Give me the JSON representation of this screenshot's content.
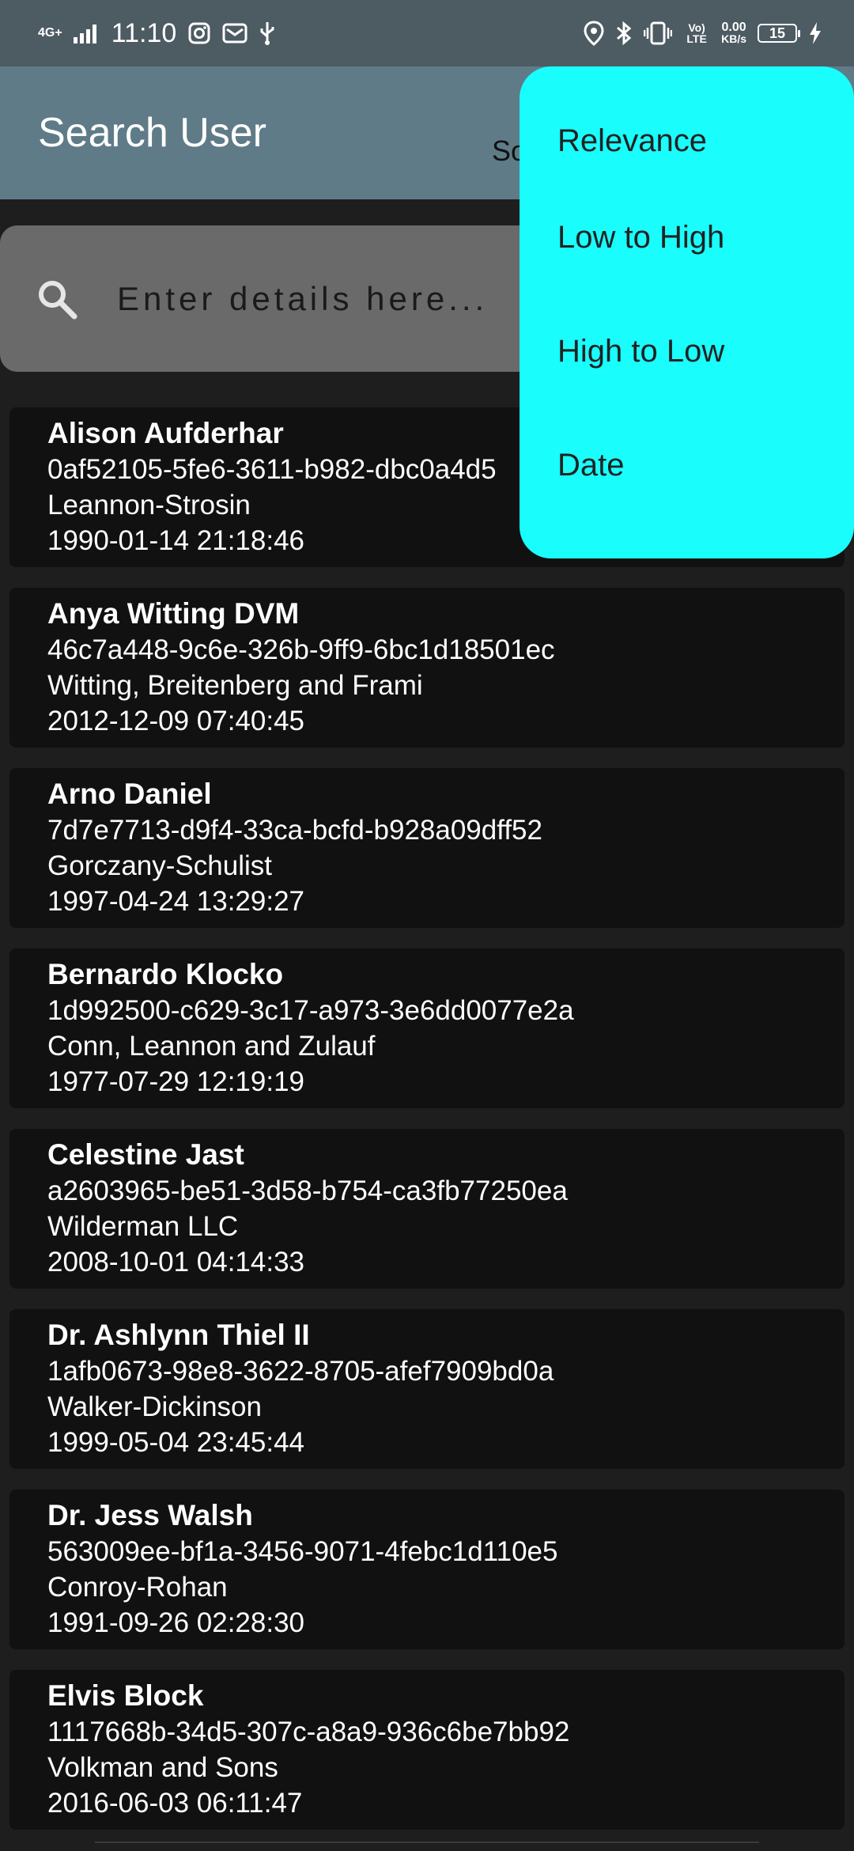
{
  "status_bar": {
    "network": "4G+",
    "time": "11:10",
    "volte": "Vo) LTE",
    "speed_value": "0.00",
    "speed_unit": "KB/s",
    "battery": "15",
    "icons": [
      "signal-icon",
      "instagram-icon",
      "mail-icon",
      "usb-icon",
      "location-icon",
      "bluetooth-icon",
      "vibrate-icon",
      "charging-icon"
    ]
  },
  "app_bar": {
    "title": "Search User",
    "sort_label": "Sor"
  },
  "search": {
    "placeholder": "Enter details here..."
  },
  "users": [
    {
      "name": "Alison Aufderhar",
      "id": "0af52105-5fe6-3611-b982-dbc0a4d5",
      "company": "Leannon-Strosin",
      "date": "1990-01-14 21:18:46"
    },
    {
      "name": "Anya Witting DVM",
      "id": "46c7a448-9c6e-326b-9ff9-6bc1d18501ec",
      "company": "Witting, Breitenberg and Frami",
      "date": "2012-12-09 07:40:45"
    },
    {
      "name": "Arno Daniel",
      "id": "7d7e7713-d9f4-33ca-bcfd-b928a09dff52",
      "company": "Gorczany-Schulist",
      "date": "1997-04-24 13:29:27"
    },
    {
      "name": "Bernardo Klocko",
      "id": "1d992500-c629-3c17-a973-3e6dd0077e2a",
      "company": "Conn, Leannon and Zulauf",
      "date": "1977-07-29 12:19:19"
    },
    {
      "name": "Celestine Jast",
      "id": "a2603965-be51-3d58-b754-ca3fb77250ea",
      "company": "Wilderman LLC",
      "date": "2008-10-01 04:14:33"
    },
    {
      "name": "Dr. Ashlynn Thiel II",
      "id": "1afb0673-98e8-3622-8705-afef7909bd0a",
      "company": "Walker-Dickinson",
      "date": "1999-05-04 23:45:44"
    },
    {
      "name": "Dr. Jess Walsh",
      "id": "563009ee-bf1a-3456-9071-4febc1d110e5",
      "company": "Conroy-Rohan",
      "date": "1991-09-26 02:28:30"
    },
    {
      "name": "Elvis Block",
      "id": "1117668b-34d5-307c-a8a9-936c6be7bb92",
      "company": "Volkman and Sons",
      "date": "2016-06-03 06:11:47"
    }
  ],
  "sort_menu": {
    "items": [
      "Relevance",
      "Low to High",
      "High to Low",
      "Date"
    ]
  },
  "colors": {
    "status_bar": "#4d5b63",
    "app_bar": "#5f7b88",
    "menu": "#19fdfd",
    "card": "#111111",
    "background": "#1e1e1e"
  }
}
